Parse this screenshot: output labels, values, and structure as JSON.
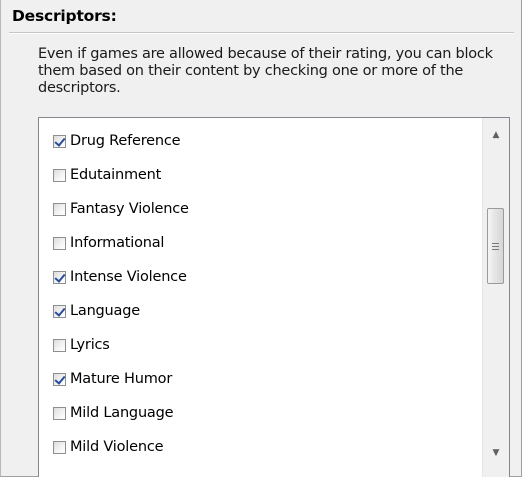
{
  "section": {
    "heading": "Descriptors:",
    "description": "Even if games are allowed because of their rating, you can block them based on their content by checking one or more of the descriptors."
  },
  "descriptors": [
    {
      "label": "Drug Reference",
      "checked": true
    },
    {
      "label": "Edutainment",
      "checked": false
    },
    {
      "label": "Fantasy Violence",
      "checked": false
    },
    {
      "label": "Informational",
      "checked": false
    },
    {
      "label": "Intense Violence",
      "checked": true
    },
    {
      "label": "Language",
      "checked": true
    },
    {
      "label": "Lyrics",
      "checked": false
    },
    {
      "label": "Mature Humor",
      "checked": true
    },
    {
      "label": "Mild Language",
      "checked": false
    },
    {
      "label": "Mild Violence",
      "checked": false
    }
  ],
  "scrollbar": {
    "up_icon": "scroll-up-arrow-icon",
    "down_icon": "scroll-down-arrow-icon",
    "thumb_icon": "grip-icon"
  },
  "colors": {
    "panel_bg": "#f0f0f0",
    "checkmark": "#2a4c9e",
    "list_border": "#828790"
  }
}
